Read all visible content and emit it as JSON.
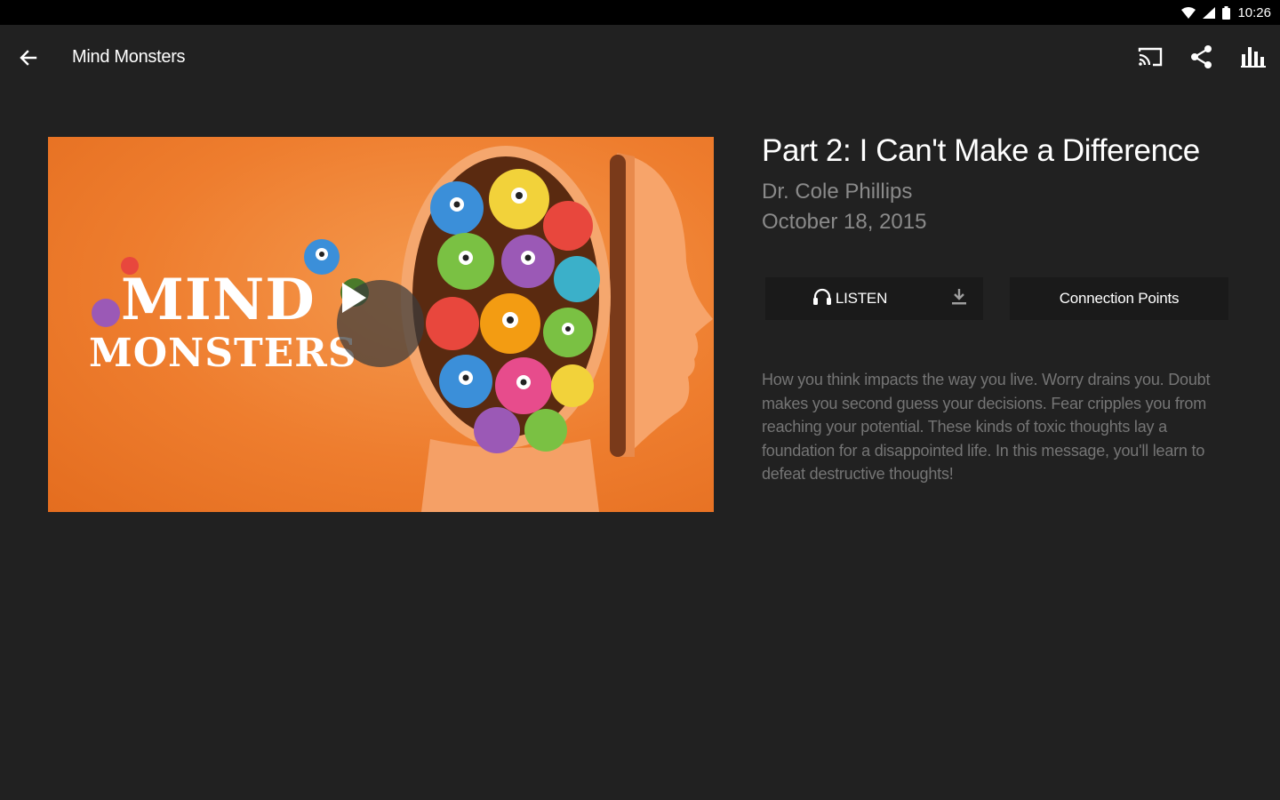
{
  "status_bar": {
    "time": "10:26",
    "icons": [
      "wifi-icon",
      "signal-icon",
      "battery-icon"
    ]
  },
  "app_bar": {
    "title": "Mind Monsters",
    "back_icon": "arrow-left-icon",
    "actions": [
      "cast-icon",
      "share-icon",
      "bar-chart-icon"
    ]
  },
  "artwork": {
    "title_line_1": "MIND",
    "title_line_2": "MONSTERS",
    "play_icon": "play-icon"
  },
  "episode": {
    "title": "Part 2: I Can't Make a Difference",
    "speaker": "Dr. Cole Phillips",
    "date": "October 18, 2015",
    "listen_label": "LISTEN",
    "connection_label": "Connection Points",
    "description": "How you think impacts the way you live. Worry drains you. Doubt makes you second guess your decisions. Fear cripples you from reaching your potential. These kinds of toxic thoughts lay a foundation for a disappointed life. In this message, you'll learn to defeat destructive thoughts!"
  },
  "colors": {
    "background": "#212121",
    "status_bar": "#000000",
    "artwork_orange": "#ee7d2e",
    "secondary_text": "#8a8a8a",
    "description_text": "#757575",
    "button_bg": "#1a1a1a"
  }
}
